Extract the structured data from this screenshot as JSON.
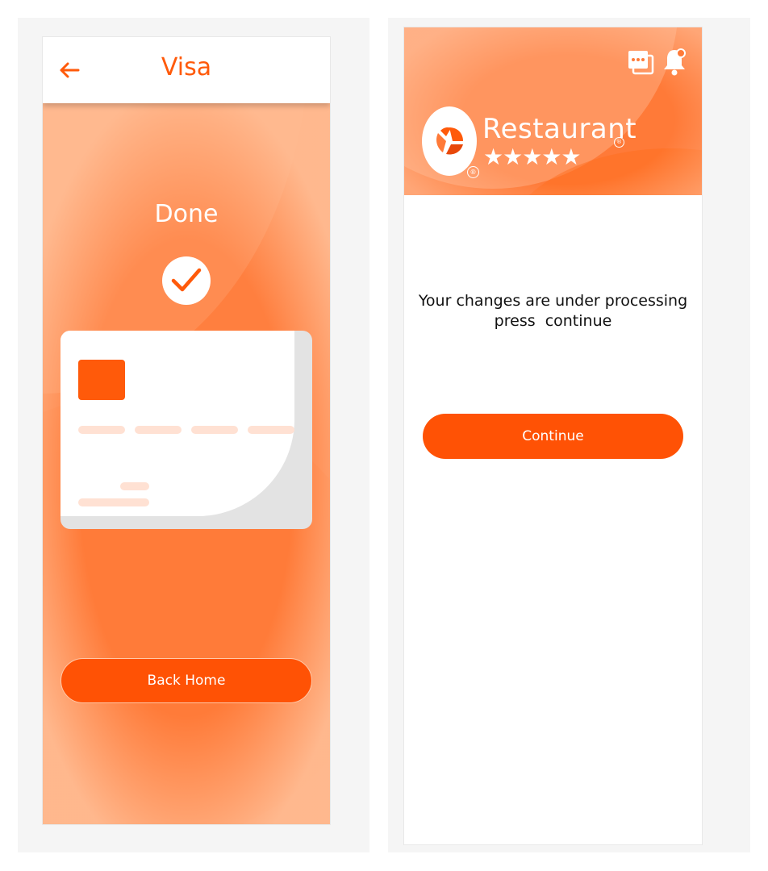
{
  "colors": {
    "accent": "#ff5a0a",
    "button": "#ff5205",
    "header_orange": "#ff7a38",
    "page_orange": "#ff7f3f",
    "white": "#ffffff"
  },
  "left_screen": {
    "header": {
      "back_icon": "arrow-left-icon",
      "title": "Visa"
    },
    "status_text": "Done",
    "status_icon": "checkmark-icon",
    "card_icon": "credit-card-illustration",
    "back_home_label": "Back Home"
  },
  "right_screen": {
    "header": {
      "icons": [
        "calendar-icon",
        "bell-icon"
      ],
      "logo_icon": "restaurant-logo-icon",
      "restaurant_name": "Restaurant",
      "rating_stars": "★★★★★",
      "rating_value": 5
    },
    "message_line_1": "Your changes are under processing",
    "message_line_2": "press  continue",
    "continue_label": "Continue"
  }
}
